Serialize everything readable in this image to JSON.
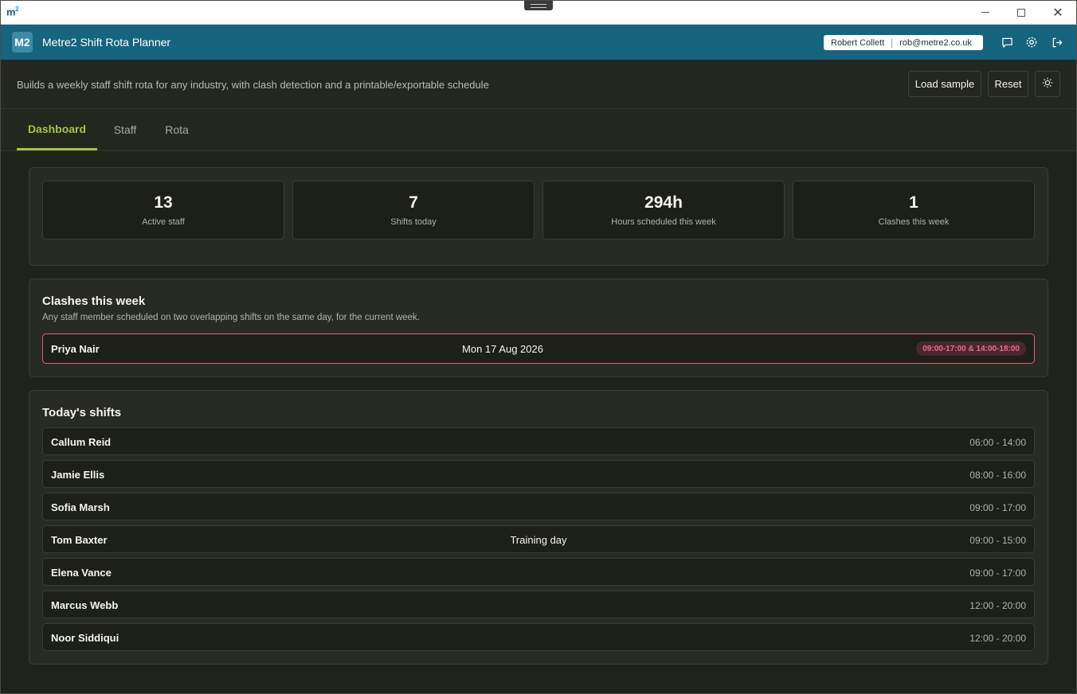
{
  "window": {
    "logo_text": "m",
    "logo_sup": "2"
  },
  "app": {
    "badge": "M2",
    "title": "Metre2 Shift Rota Planner",
    "user_name": "Robert Collett",
    "user_email": "rob@metre2.co.uk"
  },
  "subheader": {
    "description": "Builds a weekly staff shift rota for any industry, with clash detection and a printable/exportable schedule",
    "load_sample_label": "Load sample",
    "reset_label": "Reset"
  },
  "tabs": [
    {
      "label": "Dashboard",
      "active": true
    },
    {
      "label": "Staff",
      "active": false
    },
    {
      "label": "Rota",
      "active": false
    }
  ],
  "stats": [
    {
      "value": "13",
      "label": "Active staff"
    },
    {
      "value": "7",
      "label": "Shifts today"
    },
    {
      "value": "294h",
      "label": "Hours scheduled this week"
    },
    {
      "value": "1",
      "label": "Clashes this week"
    }
  ],
  "clashes": {
    "title": "Clashes this week",
    "subtitle": "Any staff member scheduled on two overlapping shifts on the same day, for the current week.",
    "items": [
      {
        "name": "Priya Nair",
        "date": "Mon 17 Aug 2026",
        "times": "09:00-17:00 & 14:00-18:00"
      }
    ]
  },
  "today": {
    "title": "Today's shifts",
    "shifts": [
      {
        "name": "Callum Reid",
        "note": "",
        "time": "06:00 - 14:00"
      },
      {
        "name": "Jamie Ellis",
        "note": "",
        "time": "08:00 - 16:00"
      },
      {
        "name": "Sofia Marsh",
        "note": "",
        "time": "09:00 - 17:00"
      },
      {
        "name": "Tom Baxter",
        "note": "Training day",
        "time": "09:00 - 15:00"
      },
      {
        "name": "Elena Vance",
        "note": "",
        "time": "09:00 - 17:00"
      },
      {
        "name": "Marcus Webb",
        "note": "",
        "time": "12:00 - 20:00"
      },
      {
        "name": "Noor Siddiqui",
        "note": "",
        "time": "12:00 - 20:00"
      }
    ]
  },
  "colors": {
    "accent": "#a5c447",
    "header": "#17647e",
    "clash": "#e0607e"
  },
  "icons": [
    "chat-icon",
    "gear-icon",
    "logout-icon",
    "sun-icon",
    "minimize-icon",
    "maximize-icon",
    "close-icon"
  ]
}
